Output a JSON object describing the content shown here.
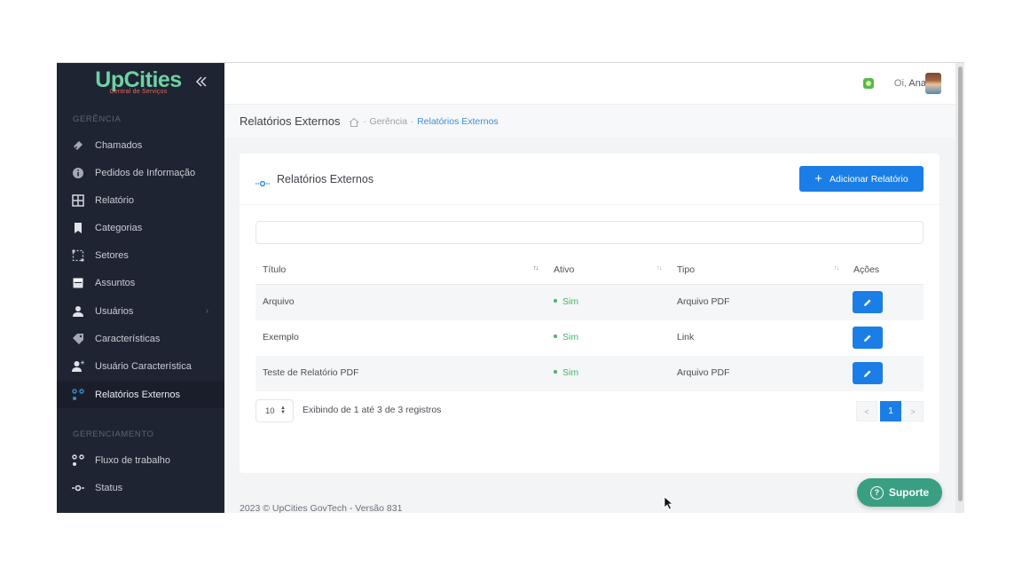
{
  "sidebar": {
    "logo_main": "UpCities",
    "logo_sub": "Central de Serviços",
    "section_gerencia": "GERÊNCIA",
    "section_gerenciamento": "GERENCIAMENTO",
    "items": [
      {
        "label": "Chamados",
        "icon": "ticket-icon"
      },
      {
        "label": "Pedidos de Informação",
        "icon": "info-icon"
      },
      {
        "label": "Relatório",
        "icon": "grid-icon"
      },
      {
        "label": "Categorias",
        "icon": "bookmark-icon"
      },
      {
        "label": "Setores",
        "icon": "sectors-icon"
      },
      {
        "label": "Assuntos",
        "icon": "calendar-icon"
      },
      {
        "label": "Usuários",
        "icon": "user-icon"
      },
      {
        "label": "Características",
        "icon": "tag-icon"
      },
      {
        "label": "Usuário Característica",
        "icon": "user-plus-icon"
      },
      {
        "label": "Relatórios Externos",
        "icon": "external-report-icon"
      },
      {
        "label": "Fluxo de trabalho",
        "icon": "workflow-icon"
      },
      {
        "label": "Status",
        "icon": "status-icon"
      }
    ]
  },
  "topbar": {
    "greeting_prefix": "Oi,",
    "user_name": "Ana"
  },
  "breadcrumb": {
    "page_title": "Relatórios Externos",
    "items": [
      "Gerência",
      "Relatórios Externos"
    ]
  },
  "card": {
    "title": "Relatórios Externos",
    "add_button_label": "Adicionar Relatório",
    "search_value": "",
    "search_placeholder": ""
  },
  "table": {
    "columns": [
      "Título",
      "Ativo",
      "Tipo",
      "Ações"
    ],
    "rows": [
      {
        "titulo": "Arquivo",
        "ativo": "Sim",
        "tipo": "Arquivo PDF"
      },
      {
        "titulo": "Exemplo",
        "ativo": "Sim",
        "tipo": "Link"
      },
      {
        "titulo": "Teste de Relatório PDF",
        "ativo": "Sim",
        "tipo": "Arquivo PDF"
      }
    ]
  },
  "pagination": {
    "page_size": "10",
    "records_info": "Exibindo de 1 até 3 de 3 registros",
    "prev": "<",
    "current_page": "1",
    "next": ">"
  },
  "footer": {
    "copyright": "2023 © UpCities GovTech - Versão 831"
  },
  "support": {
    "label": "Suporte"
  },
  "colors": {
    "sidebar_bg": "#1f2432",
    "brand_green": "#6fd1a4",
    "primary_blue": "#1a7ee6",
    "status_green": "#47b36c",
    "support_green": "#3a9f82"
  }
}
